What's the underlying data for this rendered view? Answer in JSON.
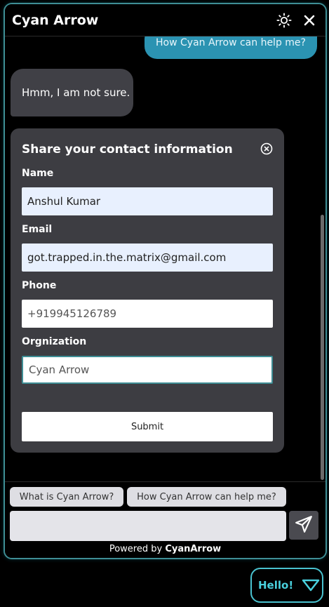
{
  "header": {
    "title": "Cyan Arrow",
    "theme_icon": "sun-icon",
    "close_icon": "close-icon"
  },
  "messages": {
    "user": "How Cyan Arrow can help me?",
    "bot": "Hmm, I am not sure."
  },
  "form": {
    "title": "Share your contact information",
    "fields": [
      {
        "label": "Name",
        "value": "Anshul Kumar"
      },
      {
        "label": "Email",
        "value": "got.trapped.in.the.matrix@gmail.com"
      },
      {
        "label": "Phone",
        "value": "+919945126789"
      },
      {
        "label": "Orgnization",
        "value": "Cyan Arrow"
      }
    ],
    "submit_label": "Submit"
  },
  "suggestions": [
    "What is Cyan Arrow?",
    "How Cyan Arrow can help me?"
  ],
  "composer": {
    "value": "",
    "send_icon": "send-icon"
  },
  "footer": {
    "powered_by": "Powered by",
    "brand": "CyanArrow"
  },
  "launcher": {
    "label": "Hello!",
    "icon": "triangle-down-icon"
  },
  "colors": {
    "accent": "#49c2cf",
    "user_bubble": "#2b93b2",
    "bot_bubble": "#404046",
    "card": "#3d3d42"
  }
}
